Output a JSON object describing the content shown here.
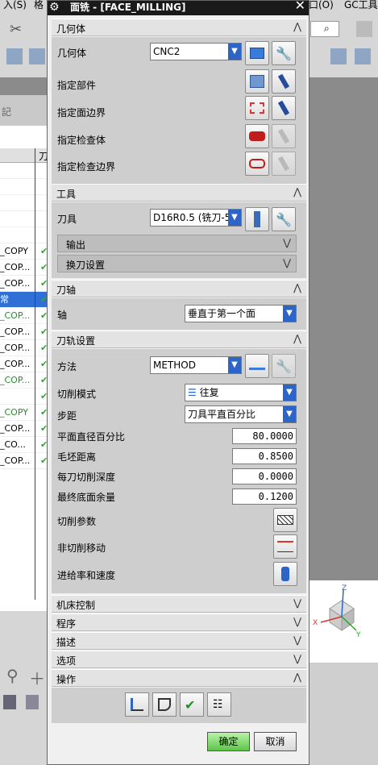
{
  "window": {
    "title": "面铣 - [FACE_MILLING]",
    "close": "✕"
  },
  "bg": {
    "menu1": "入(S)",
    "menu2": "格",
    "menu3": "口(O)",
    "menu4": "GC工具",
    "panel_label": "記",
    "col_head": "刀"
  },
  "tree_rows": [
    {
      "text": "",
      "check": ""
    },
    {
      "text": "",
      "check": ""
    },
    {
      "text": "",
      "check": ""
    },
    {
      "text": "",
      "check": ""
    },
    {
      "text": "",
      "check": ""
    },
    {
      "text": "_COPY",
      "check": "✔"
    },
    {
      "text": "_COP...",
      "check": "✔"
    },
    {
      "text": "_COP...",
      "check": "✔"
    },
    {
      "text": "常",
      "check": "✔",
      "sel": true
    },
    {
      "text": "_COP...",
      "check": "✔",
      "green": true
    },
    {
      "text": "_COP...",
      "check": "✔"
    },
    {
      "text": "_COP...",
      "check": "✔"
    },
    {
      "text": "_COP...",
      "check": "✔"
    },
    {
      "text": "_COP...",
      "check": "✔",
      "green": true
    },
    {
      "text": "",
      "check": "✔"
    },
    {
      "text": "_COPY",
      "check": "✔",
      "green": true
    },
    {
      "text": "_COP...",
      "check": "✔"
    },
    {
      "text": "_CO...",
      "check": "✔"
    },
    {
      "text": "_COP...",
      "check": "✔"
    }
  ],
  "sections": {
    "geometry": "几何体",
    "tool": "工具",
    "axis": "刀轴",
    "path": "刀轨设置",
    "machine": "机床控制",
    "program": "程序",
    "desc": "描述",
    "options": "选项",
    "actions": "操作"
  },
  "geometry": {
    "geom_label": "几何体",
    "geom_value": "CNC2",
    "part": "指定部件",
    "face": "指定面边界",
    "check": "指定检查体",
    "check_bd": "指定检查边界"
  },
  "tool": {
    "label": "刀具",
    "value": "D16R0.5 (铣刀-5",
    "output": "输出",
    "change": "换刀设置"
  },
  "axis": {
    "label": "轴",
    "value": "垂直于第一个面"
  },
  "path": {
    "method_label": "方法",
    "method_value": "METHOD",
    "cut_mode_label": "切削模式",
    "cut_mode_value": "往复",
    "step_label": "步距",
    "step_value": "刀具平直百分比",
    "face_pct_label": "平面直径百分比",
    "face_pct": "80.0000",
    "blank_label": "毛坯距离",
    "blank": "0.8500",
    "depth_label": "每刀切削深度",
    "depth": "0.0000",
    "floor_label": "最终底面余量",
    "floor": "0.1200",
    "cut_params": "切削参数",
    "noncut": "非切削移动",
    "feeds": "进给率和速度"
  },
  "buttons": {
    "ok": "确定",
    "cancel": "取消"
  },
  "colors": {
    "accent": "#2d64c8",
    "check": "#2fa52f",
    "title_bar": "#1a1a1a"
  }
}
